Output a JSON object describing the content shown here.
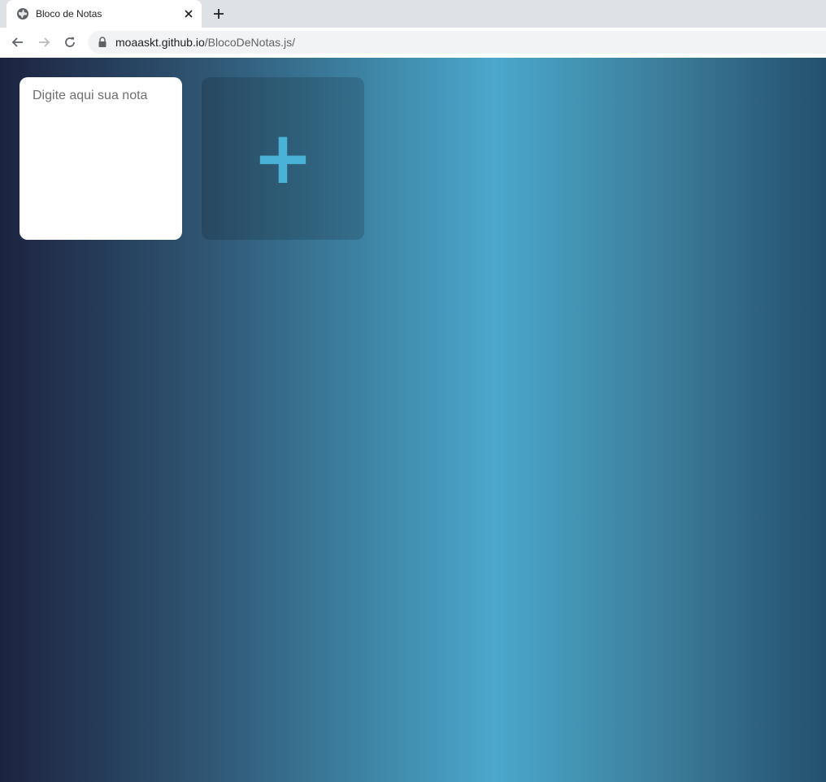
{
  "browser": {
    "tab": {
      "title": "Bloco de Notas",
      "favicon": "globe-icon",
      "close_icon": "close-icon"
    },
    "new_tab_icon": "plus-icon",
    "toolbar": {
      "back_icon": "back-arrow-icon",
      "forward_icon": "forward-arrow-icon",
      "reload_icon": "reload-icon",
      "lock_icon": "lock-icon",
      "url_host": "moaaskt.github.io",
      "url_path": "/BlocoDeNotas.js/"
    }
  },
  "page": {
    "note": {
      "placeholder": "Digite aqui sua nota",
      "value": ""
    },
    "add_button": {
      "glyph": "+",
      "icon": "plus-icon"
    }
  },
  "colors": {
    "gradient_left": "#1c2340",
    "gradient_mid": "#4aa8cc",
    "gradient_right": "#23506e",
    "plus_accent": "#4ab2d6"
  }
}
